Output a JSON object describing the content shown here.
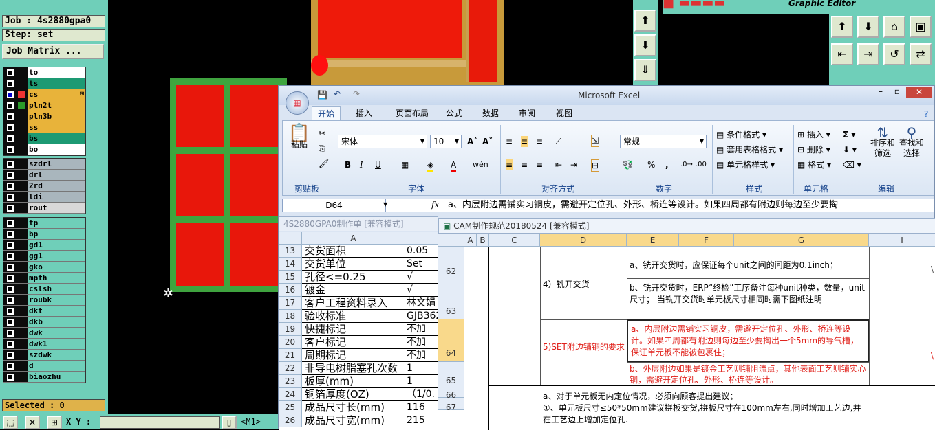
{
  "genesis": {
    "job_label": "Job : 4s2880gpa0",
    "step_label": "Step: set",
    "job_matrix_button": "Job Matrix ...",
    "layers_group1": [
      {
        "name": "to",
        "color": "#ffffff"
      },
      {
        "name": "ts",
        "color": "#1d9a73"
      },
      {
        "name": "cs",
        "color": "#e8b33a",
        "marker": "⊞"
      },
      {
        "name": "pln2t",
        "color": "#e8b33a"
      },
      {
        "name": "pln3b",
        "color": "#e8b33a"
      },
      {
        "name": "ss",
        "color": "#e8b33a"
      },
      {
        "name": "bs",
        "color": "#1d9a73"
      },
      {
        "name": "bo",
        "color": "#ffffff"
      }
    ],
    "layers_group2": [
      {
        "name": "szdrl",
        "color": "#a9b6bd"
      },
      {
        "name": "drl",
        "color": "#a9b6bd"
      },
      {
        "name": "2rd",
        "color": "#a9b6bd"
      },
      {
        "name": "ldi",
        "color": "#a9b6bd"
      },
      {
        "name": "rout",
        "color": "#d8d8d8"
      }
    ],
    "layers_group3": [
      {
        "name": "tp"
      },
      {
        "name": "bp"
      },
      {
        "name": "gd1"
      },
      {
        "name": "gg1"
      },
      {
        "name": "gko"
      },
      {
        "name": "mpth"
      },
      {
        "name": "cslsh"
      },
      {
        "name": "roubk"
      },
      {
        "name": "dkt"
      },
      {
        "name": "dkb"
      },
      {
        "name": "dwk"
      },
      {
        "name": "dwk1"
      },
      {
        "name": "szdwk"
      },
      {
        "name": "d"
      },
      {
        "name": "biaozhu"
      }
    ],
    "selected_label": "Selected : 0",
    "xy_label": "X Y :",
    "m1_label": "<M1>",
    "editor_title": "Graphic Editor"
  },
  "excel": {
    "app_title": "Microsoft Excel",
    "tabs": [
      "开始",
      "插入",
      "页面布局",
      "公式",
      "数据",
      "审阅",
      "视图"
    ],
    "groups": [
      "剪贴板",
      "字体",
      "对齐方式",
      "数字",
      "样式",
      "单元格",
      "编辑"
    ],
    "paste_label": "粘贴",
    "font_name": "宋体",
    "font_size": "10",
    "number_format": "常规",
    "style_items": [
      "条件格式",
      "套用表格格式",
      "单元格样式"
    ],
    "cell_items": [
      "插入",
      "删除",
      "格式"
    ],
    "edit_items": [
      "排序和\n筛选",
      "查找和\n选择"
    ],
    "name_box": "D64",
    "fx": "fx",
    "formula": "a、内层附边需铺实习铜皮，需避开定位孔、外形、桥连等设计。如果四周都有附边则每边至少要掏",
    "wb1_title": "4S2880GPA0制作单 [兼容模式]",
    "wb1_col": "A",
    "wb1_rows": [
      {
        "n": "13",
        "a": "交货面积",
        "b": "0.05"
      },
      {
        "n": "14",
        "a": "交货单位",
        "b": "Set"
      },
      {
        "n": "15",
        "a": "孔径<=0.25",
        "b": "√"
      },
      {
        "n": "16",
        "a": "镀金",
        "b": "√"
      },
      {
        "n": "17",
        "a": "客户工程资料录入",
        "b": "林文娟"
      },
      {
        "n": "18",
        "a": "验收标准",
        "b": "GJB362"
      },
      {
        "n": "19",
        "a": "快捷标记",
        "b": "不加"
      },
      {
        "n": "20",
        "a": "客户标记",
        "b": "不加"
      },
      {
        "n": "21",
        "a": "周期标记",
        "b": "不加"
      },
      {
        "n": "22",
        "a": "非导电树脂塞孔次数",
        "b": "1"
      },
      {
        "n": "23",
        "a": "板厚(mm)",
        "b": "1"
      },
      {
        "n": "24",
        "a": "铜箔厚度(OZ)",
        "b": "（1/0."
      },
      {
        "n": "25",
        "a": "成品尺寸长(mm)",
        "b": "116"
      },
      {
        "n": "26",
        "a": "成品尺寸宽(mm)",
        "b": "215"
      }
    ],
    "wb2_title": "CAM制作规范20180524 [兼容模式]",
    "wb2_cols": [
      "A",
      "B",
      "C",
      "D",
      "E",
      "F",
      "G",
      "I"
    ],
    "wb2_rows": [
      "62",
      "63",
      "64",
      "65",
      "66",
      "67"
    ],
    "c_mill": "4）铣开交货",
    "d62": "a、铣开交货时，应保证每个unit之间的间距为0.1inch；",
    "d63": "b、铣开交货时，ERP“终检”工序备注每种unit种类，数量，unit尺寸； 当铣开交货时单元板尺寸相同时需下图纸注明",
    "c_set": "5)SET附边铺铜的要求",
    "d64": "a、内层附边需铺实习铜皮，需避开定位孔、外形、桥连等设计。如果四周都有附边则每边至少要掏出一个5mm的导气槽，保证单元板不能被包裹住；",
    "d65": "b、外层附边如果是镀金工艺则铺阻流点，其他表面工艺则铺实心铜，需避开定位孔、外形、桥连等设计。",
    "d66": "a、对于单元板无内定位情况，必须向顾客提出建议；\n①、单元板尺寸≤50*50mm建议拼板交货,拼板尺寸在100mm左右,同时增加工艺边,并在工艺边上增加定位孔."
  }
}
